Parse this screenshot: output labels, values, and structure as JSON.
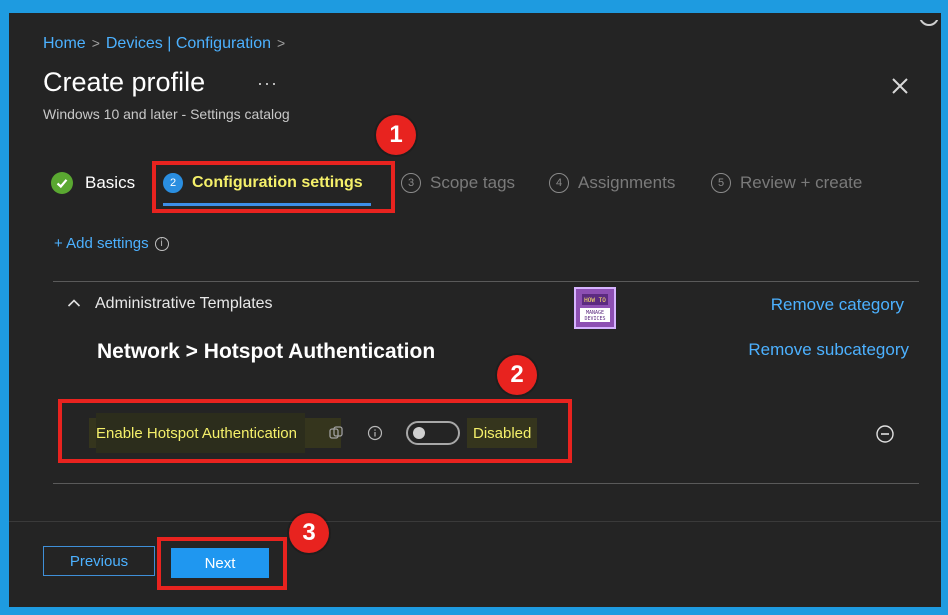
{
  "breadcrumb": {
    "home": "Home",
    "devices": "Devices | Configuration",
    "separator": ">"
  },
  "header": {
    "title": "Create profile",
    "more": "···",
    "subtitle": "Windows 10 and later - Settings catalog"
  },
  "tabs": [
    {
      "num": "",
      "label": "Basics",
      "state": "done"
    },
    {
      "num": "2",
      "label": "Configuration settings",
      "state": "active"
    },
    {
      "num": "3",
      "label": "Scope tags",
      "state": "inactive"
    },
    {
      "num": "4",
      "label": "Assignments",
      "state": "inactive"
    },
    {
      "num": "5",
      "label": "Review + create",
      "state": "inactive"
    }
  ],
  "add_settings": {
    "label": "+ Add settings",
    "info_icon": "i"
  },
  "category": {
    "name": "Administrative Templates",
    "remove_label": "Remove category"
  },
  "subcategory": {
    "name": "Network > Hotspot Authentication",
    "remove_label": "Remove subcategory"
  },
  "setting": {
    "label": "Enable Hotspot Authentication",
    "toggle_value": "Disabled",
    "enabled": false
  },
  "logo": {
    "line1": "HOW TO",
    "line2": "MANAGE DEVICES"
  },
  "annotations": [
    "1",
    "2",
    "3"
  ],
  "footer": {
    "previous_label": "Previous",
    "next_label": "Next"
  },
  "colors": {
    "accent": "#4cb1ff",
    "highlight_text": "#f5f06a",
    "annotation_red": "#e8231f",
    "background": "#242424",
    "frame": "#1e9be0"
  }
}
